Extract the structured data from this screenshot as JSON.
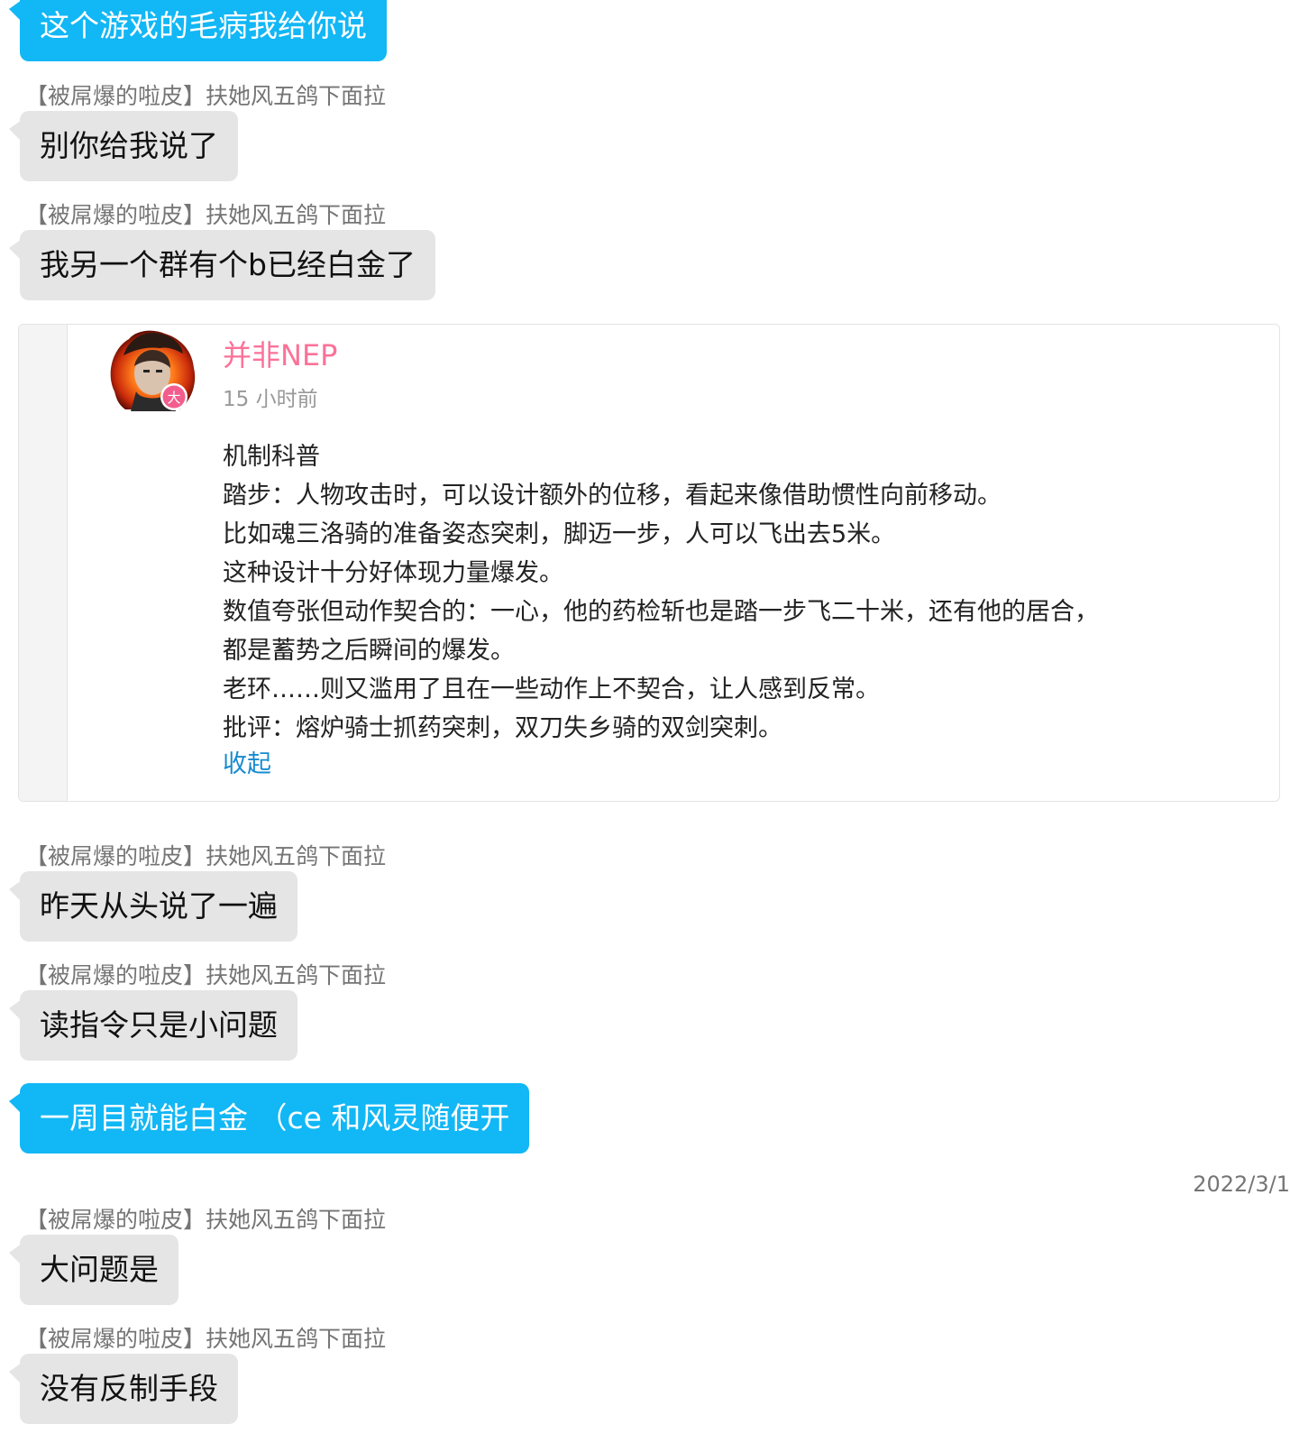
{
  "messages": [
    {
      "id": "m1",
      "sender": "",
      "text": "这个游戏的毛病我给你说",
      "style": "blue"
    },
    {
      "id": "m2",
      "sender": "【被屌爆的啦皮】扶她风五鸽下面拉",
      "text": "别你给我说了",
      "style": "gray"
    },
    {
      "id": "m3",
      "sender": "【被屌爆的啦皮】扶她风五鸽下面拉",
      "text": "我另一个群有个b已经白金了",
      "style": "gray"
    },
    {
      "id": "m4",
      "sender": "【被屌爆的啦皮】扶她风五鸽下面拉",
      "text": "昨天从头说了一遍",
      "style": "gray"
    },
    {
      "id": "m5",
      "sender": "【被屌爆的啦皮】扶她风五鸽下面拉",
      "text": "读指令只是小问题",
      "style": "gray"
    },
    {
      "id": "m6",
      "sender": "",
      "text": "一周目就能白金 （ce 和风灵随便开",
      "style": "blue"
    },
    {
      "id": "m7",
      "sender": "【被屌爆的啦皮】扶她风五鸽下面拉",
      "text": "大问题是",
      "style": "gray"
    },
    {
      "id": "m8",
      "sender": "【被屌爆的啦皮】扶她风五鸽下面拉",
      "text": "没有反制手段",
      "style": "gray"
    }
  ],
  "shared_card": {
    "author": "并非NEP",
    "time": "15 小时前",
    "avatar_badge": "大",
    "lines": [
      "机制科普",
      "踏步：人物攻击时，可以设计额外的位移，看起来像借助惯性向前移动。",
      "比如魂三洛骑的准备姿态突刺，脚迈一步，人可以飞出去5米。",
      "这种设计十分好体现力量爆发。",
      "数值夸张但动作契合的：一心，他的药检斩也是踏一步飞二十米，还有他的居合，",
      "都是蓄势之后瞬间的爆发。",
      "老环……则又滥用了且在一些动作上不契合，让人感到反常。",
      "批评：熔炉骑士抓药突刺，双刀失乡骑的双剑突刺。"
    ],
    "collapse_label": "收起"
  },
  "date_divider": "2022/3/1",
  "colors": {
    "self_bubble": "#12b7f5",
    "other_bubble": "#e5e5e5",
    "author_name": "#fb7299",
    "link": "#178bcf"
  }
}
